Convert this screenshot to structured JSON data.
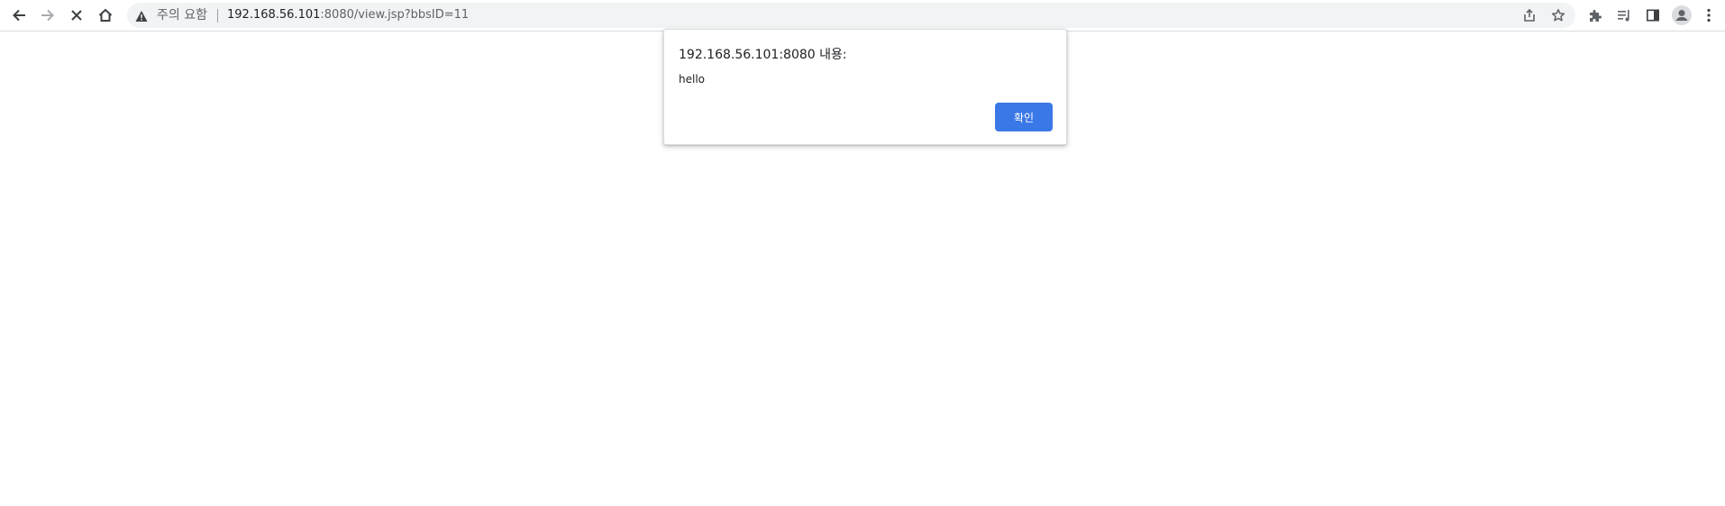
{
  "browser": {
    "toolbar": {
      "back_icon": "back-arrow-icon",
      "forward_icon": "forward-arrow-icon",
      "stop_icon": "close-x-icon",
      "home_icon": "home-icon"
    },
    "omnibox": {
      "security_icon": "warning-triangle-icon",
      "security_label": "주의 요함",
      "url_host": "192.168.56.101",
      "url_rest": ":8080/view.jsp?bbsID=11",
      "share_icon": "share-icon",
      "bookmark_icon": "star-icon"
    },
    "right_icons": [
      "extensions-puzzle-icon",
      "media-control-icon",
      "side-panel-icon",
      "profile-avatar-icon",
      "menu-kebab-icon"
    ]
  },
  "dialog": {
    "title": "192.168.56.101:8080 내용:",
    "message": "hello",
    "ok_label": "확인"
  },
  "colors": {
    "accent": "#3b78e7",
    "omnibox_bg": "#f1f3f4",
    "icon": "#5f6368",
    "text": "#202124"
  }
}
